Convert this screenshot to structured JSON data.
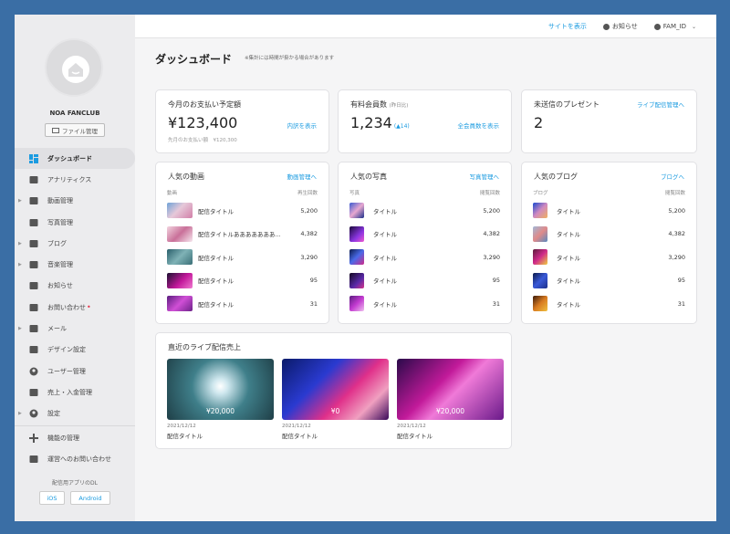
{
  "sidebar": {
    "club_name": "NOA FANCLUB",
    "file_button": "ファイル管理",
    "items": [
      {
        "label": "ダッシュボード",
        "icon": "dashboard-icon",
        "active": true,
        "caret": false,
        "dot": false
      },
      {
        "label": "アナリティクス",
        "icon": "analytics-icon",
        "active": false,
        "caret": false,
        "dot": false
      },
      {
        "label": "動画管理",
        "icon": "video-icon",
        "active": false,
        "caret": true,
        "dot": false
      },
      {
        "label": "写真管理",
        "icon": "photo-icon",
        "active": false,
        "caret": false,
        "dot": false
      },
      {
        "label": "ブログ",
        "icon": "blog-icon",
        "active": false,
        "caret": true,
        "dot": false
      },
      {
        "label": "音楽管理",
        "icon": "music-icon",
        "active": false,
        "caret": true,
        "dot": false
      },
      {
        "label": "お知らせ",
        "icon": "notice-icon",
        "active": false,
        "caret": false,
        "dot": false
      },
      {
        "label": "お問い合わせ",
        "icon": "inquiry-icon",
        "active": false,
        "caret": false,
        "dot": true
      },
      {
        "label": "メール",
        "icon": "mail-icon",
        "active": false,
        "caret": true,
        "dot": false
      },
      {
        "label": "デザイン設定",
        "icon": "design-icon",
        "active": false,
        "caret": false,
        "dot": false
      },
      {
        "label": "ユーザー管理",
        "icon": "user-icon",
        "active": false,
        "caret": false,
        "dot": false
      },
      {
        "label": "売上・入金管理",
        "icon": "sales-icon",
        "active": false,
        "caret": false,
        "dot": false
      },
      {
        "label": "設定",
        "icon": "settings-icon",
        "active": false,
        "caret": true,
        "dot": false
      }
    ],
    "extra_items": [
      {
        "label": "機能の管理",
        "icon": "plus-icon"
      },
      {
        "label": "運営へのお問い合わせ",
        "icon": "mail-icon"
      }
    ],
    "download_label": "配信用アプリのDL",
    "ios_label": "iOS",
    "android_label": "Android"
  },
  "topbar": {
    "site_link": "サイトを表示",
    "notice": "お知らせ",
    "account": "FAM_ID"
  },
  "page": {
    "title": "ダッシュボード",
    "note": "※集計には時間が掛かる場合があります"
  },
  "summary": {
    "payment": {
      "title": "今月のお支払い予定額",
      "value": "¥123,400",
      "link": "内訳を表示",
      "sub": "先月のお支払い額　¥120,300"
    },
    "members": {
      "title": "有料会員数",
      "title_sub": "(昨日比)",
      "value": "1,234",
      "delta": "(▲14)",
      "link": "全会員数を表示"
    },
    "presents": {
      "title": "未送信のプレゼント",
      "value": "2",
      "link": "ライブ配信管理へ"
    }
  },
  "popular": [
    {
      "title": "人気の動画",
      "link": "動画管理へ",
      "col1": "動画",
      "col2": "再生回数",
      "rows": [
        {
          "t": "配信タイトル",
          "v": "5,200"
        },
        {
          "t": "配信タイトルあああああああ...",
          "v": "4,382"
        },
        {
          "t": "配信タイトル",
          "v": "3,290"
        },
        {
          "t": "配信タイトル",
          "v": "95"
        },
        {
          "t": "配信タイトル",
          "v": "31"
        }
      ]
    },
    {
      "title": "人気の写真",
      "link": "写真管理へ",
      "col1": "写真",
      "col2": "閲覧回数",
      "rows": [
        {
          "t": "タイトル",
          "v": "5,200"
        },
        {
          "t": "タイトル",
          "v": "4,382"
        },
        {
          "t": "タイトル",
          "v": "3,290"
        },
        {
          "t": "タイトル",
          "v": "95"
        },
        {
          "t": "タイトル",
          "v": "31"
        }
      ]
    },
    {
      "title": "人気のブログ",
      "link": "ブログへ",
      "col1": "ブログ",
      "col2": "閲覧回数",
      "rows": [
        {
          "t": "タイトル",
          "v": "5,200"
        },
        {
          "t": "タイトル",
          "v": "4,382"
        },
        {
          "t": "タイトル",
          "v": "3,290"
        },
        {
          "t": "タイトル",
          "v": "95"
        },
        {
          "t": "タイトル",
          "v": "31"
        }
      ]
    }
  ],
  "live": {
    "title": "直近のライブ配信売上",
    "items": [
      {
        "price": "¥20,000",
        "date": "2021/12/12",
        "name": "配信タイトル"
      },
      {
        "price": "¥0",
        "date": "2021/12/12",
        "name": "配信タイトル"
      },
      {
        "price": "¥20,000",
        "date": "2021/12/12",
        "name": "配信タイトル"
      }
    ]
  },
  "colors": {
    "accent": "#1b9be0",
    "frame": "#3a6ea5",
    "alert": "#e5384d"
  }
}
